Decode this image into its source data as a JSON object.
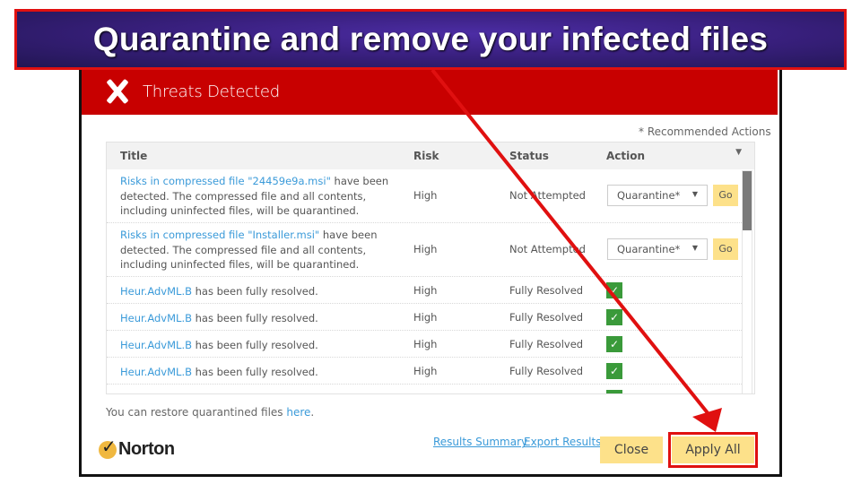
{
  "banner": {
    "text": "Quarantine and remove your infected files"
  },
  "window": {
    "header_title": "Threats Detected",
    "recommended_note": "* Recommended Actions"
  },
  "table": {
    "columns": {
      "title": "Title",
      "risk": "Risk",
      "status": "Status",
      "action": "Action"
    },
    "rows": [
      {
        "link": "Risks in compressed file \"24459e9a.msi\"",
        "text": " have been detected. The compressed file and all contents, including uninfected files, will be quarantined.",
        "risk": "High",
        "status": "Not Attempted",
        "action": "Quarantine*",
        "go": "Go"
      },
      {
        "link": "Risks in compressed file \"Installer.msi\"",
        "text": " have been detected. The compressed file and all contents, including uninfected files, will be quarantined.",
        "risk": "High",
        "status": "Not Attempted",
        "action": "Quarantine*",
        "go": "Go"
      },
      {
        "link": "Heur.AdvML.B",
        "text": " has been fully resolved.",
        "risk": "High",
        "status": "Fully Resolved"
      },
      {
        "link": "Heur.AdvML.B",
        "text": " has been fully resolved.",
        "risk": "High",
        "status": "Fully Resolved"
      },
      {
        "link": "Heur.AdvML.B",
        "text": " has been fully resolved.",
        "risk": "High",
        "status": "Fully Resolved"
      },
      {
        "link": "Heur.AdvML.B",
        "text": " has been fully resolved.",
        "risk": "High",
        "status": "Fully Resolved"
      }
    ]
  },
  "footer": {
    "restore_text": "You can restore quarantined files ",
    "restore_link": "here",
    "restore_suffix": ".",
    "logo": "Norton",
    "results_summary": "Results Summary",
    "export_results": "Export Results",
    "close": "Close",
    "apply_all": "Apply All"
  },
  "colors": {
    "header_red": "#c80000",
    "annotation_red": "#e01010",
    "button_yellow": "#fde18a",
    "link_blue": "#3a9ad9",
    "check_green": "#3a9a3a"
  }
}
